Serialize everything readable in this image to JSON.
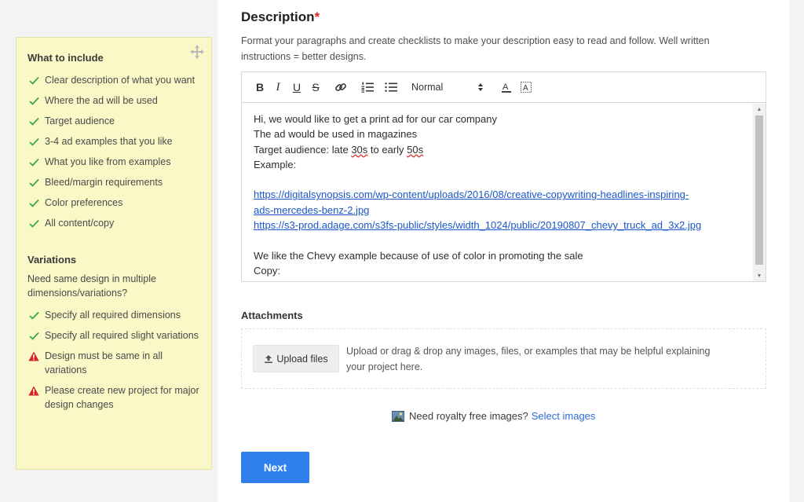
{
  "sidebar": {
    "heading": "What to include",
    "items": [
      {
        "text": "Clear description of what you want",
        "type": "check"
      },
      {
        "text": "Where the ad will be used",
        "type": "check"
      },
      {
        "text": "Target audience",
        "type": "check"
      },
      {
        "text": "3-4 ad examples that you like",
        "type": "check"
      },
      {
        "text": "What you like from examples",
        "type": "check"
      },
      {
        "text": "Bleed/margin requirements",
        "type": "check"
      },
      {
        "text": "Color preferences",
        "type": "check"
      },
      {
        "text": "All content/copy",
        "type": "check"
      }
    ],
    "variations": {
      "heading": "Variations",
      "intro": "Need same design in multiple dimensions/variations?",
      "items": [
        {
          "text": "Specify all required dimensions",
          "type": "check"
        },
        {
          "text": "Specify all required slight variations",
          "type": "check"
        },
        {
          "text": "Design must be same in all variations",
          "type": "warning"
        },
        {
          "text": "Please create new project for major design changes",
          "type": "warning"
        }
      ]
    },
    "colors": {
      "check": "#3aa843",
      "warning": "#d32323",
      "panel_bg": "#fbf8c8"
    }
  },
  "description": {
    "title": "Description",
    "required_mark": "*",
    "help": "Format your paragraphs and create checklists to make your description easy to read and follow. Well written instructions = better designs.",
    "toolbar": {
      "bold": "B",
      "italic": "I",
      "underline": "U",
      "strike": "S",
      "format_select": "Normal",
      "icons": [
        "bold-icon",
        "italic-icon",
        "underline-icon",
        "strikethrough-icon",
        "link-icon",
        "ordered-list-icon",
        "bullet-list-icon",
        "text-color-icon",
        "background-color-icon"
      ]
    },
    "content": {
      "line1": "Hi, we would like to get a print ad for our car company",
      "line2": "The ad would be used in magazines",
      "line3_pre": "Target audience: late ",
      "line3_a": "30s",
      "line3_mid": " to early ",
      "line3_b": "50s",
      "line4": "Example:",
      "link1_a": "https://digitalsynopsis.com/wp-content/uploads/2016/08/creative-copywriting-headlines-inspiring-",
      "link1_b": "ads-mercedes-benz-2.jpg",
      "link2": "https://s3-prod.adage.com/s3fs-public/styles/width_1024/public/20190807_chevy_truck_ad_3x2.jpg",
      "line8": "We like the Chevy example because of use of color in promoting the sale",
      "line9": "Copy:"
    }
  },
  "attachments": {
    "title": "Attachments",
    "upload_label": "Upload files",
    "drop_text": "Upload or drag & drop any images, files, or examples that may be helpful explaining your project here."
  },
  "royalty": {
    "question": "Need royalty free images?",
    "link": "Select images"
  },
  "next_label": "Next",
  "accent_color": "#2f80ed"
}
